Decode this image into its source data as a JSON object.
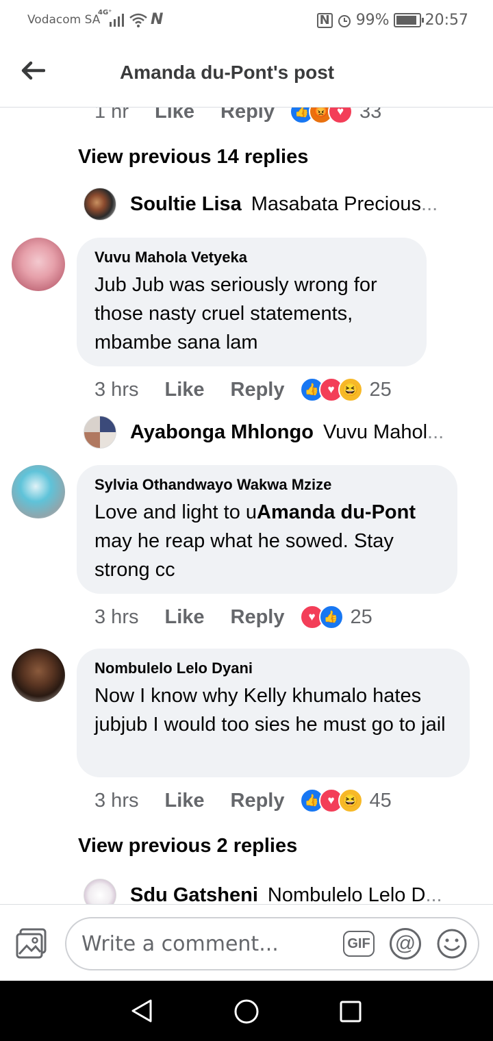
{
  "status_bar": {
    "carrier": "Vodacom SA",
    "network": "4G⁺",
    "battery": "99%",
    "battery_level": 0.99,
    "time": "20:57"
  },
  "header": {
    "title": "Amanda du-Pont's post"
  },
  "top_meta": {
    "time": "1 hr",
    "like": "Like",
    "reply": "Reply",
    "count": "33",
    "reactions": [
      "like",
      "angry",
      "love"
    ]
  },
  "view_prev_1": "View previous 14 replies",
  "reply_1": {
    "name": "Soultie Lisa",
    "text": "Masabata Precious",
    "ellipsis": "..."
  },
  "comments": [
    {
      "name": "Vuvu Mahola Vetyeka",
      "text": "Jub Jub was seriously wrong for those nasty cruel statements, mbambe sana lam",
      "time": "3 hrs",
      "like": "Like",
      "reply": "Reply",
      "count": "25",
      "reactions": [
        "like",
        "love",
        "haha"
      ]
    },
    {
      "name": "Sylvia Othandwayo Wakwa Mzize",
      "text_pre": "Love and light to u",
      "mention": "Amanda du-Pont",
      "text_post": " may he  reap what he sowed. Stay strong cc",
      "time": "3 hrs",
      "like": "Like",
      "reply": "Reply",
      "count": "25",
      "reactions": [
        "love",
        "like"
      ]
    },
    {
      "name": "Nombulelo Lelo Dyani",
      "text": "Now I know why Kelly khumalo hates jubjub I would too sies he must go to jail",
      "time": "3 hrs",
      "like": "Like",
      "reply": "Reply",
      "count": "45",
      "reactions": [
        "like",
        "love",
        "haha"
      ]
    }
  ],
  "reply_2": {
    "name": "Ayabonga Mhlongo",
    "text": "Vuvu Mahol",
    "ellipsis": "..."
  },
  "view_prev_2": "View previous 2 replies",
  "reply_3": {
    "name": "Sdu Gatsheni",
    "text": "Nombulelo Lelo D",
    "ellipsis": "..."
  },
  "composer": {
    "placeholder": "Write a comment...",
    "gif": "GIF",
    "at": "@"
  },
  "icons": [
    "back-arrow-icon",
    "photo-icon",
    "gif-icon",
    "mention-icon",
    "emoji-icon",
    "nav-back-icon",
    "nav-home-icon",
    "nav-recents-icon"
  ]
}
